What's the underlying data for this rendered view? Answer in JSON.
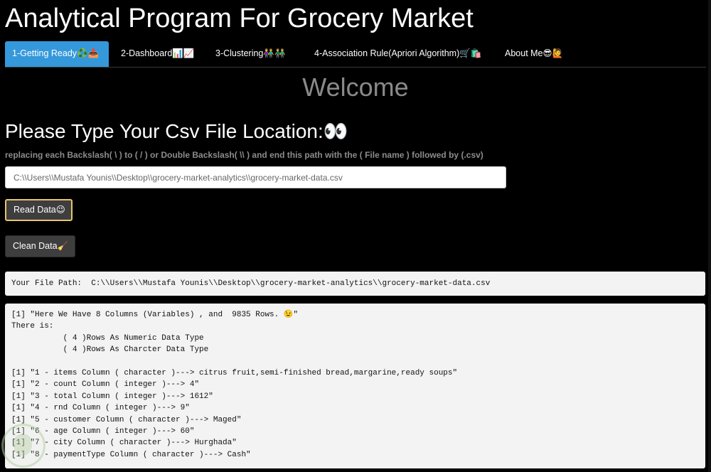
{
  "app": {
    "title": "Analytical Program For Grocery Market"
  },
  "tabs": [
    {
      "label": "1-Getting Ready♻️📥",
      "active": true
    },
    {
      "label": "2-Dashboard📊📈",
      "active": false
    },
    {
      "label": "3-Clustering👫👬",
      "active": false
    },
    {
      "label": "4-Association Rule(Apriori Algorithm)🛒🛍️",
      "active": false
    },
    {
      "label": "About Me😎🙋",
      "active": false
    }
  ],
  "main": {
    "welcome": "Welcome",
    "heading": "Please Type Your Csv File Location:👀",
    "hint": "replacing each Backslash( \\ ) to ( / ) or Double Backslash( \\\\ ) and end this path with the ( File name ) followed by (.csv)",
    "path_input": {
      "value": "C:\\\\Users\\\\Mustafa Younis\\\\Desktop\\\\grocery-market-analytics\\\\grocery-market-data.csv",
      "placeholder": ""
    },
    "read_button": "Read Data😉",
    "clean_button": "Clean Data🧹",
    "file_path_output": "Your File Path:  C:\\\\Users\\\\Mustafa Younis\\\\Desktop\\\\grocery-market-analytics\\\\grocery-market-data.csv",
    "console": [
      "[1] \"Here We Have 8 Columns (Variables) , and  9835 Rows. 😉\"",
      "There is:",
      "           ( 4 )Rows As Numeric Data Type",
      "           ( 4 )Rows As Charcter Data Type",
      "",
      "[1] \"1 - items Column ( character )---> citrus fruit,semi-finished bread,margarine,ready soups\"",
      "[1] \"2 - count Column ( integer )---> 4\"",
      "[1] \"3 - total Column ( integer )---> 1612\"",
      "[1] \"4 - rnd Column ( integer )---> 9\"",
      "[1] \"5 - customer Column ( character )---> Maged\"",
      "[1] \"6 - age Column ( integer )---> 60\"",
      "[1] \"7 - city Column ( character )---> Hurghada\"",
      "[1] \"8 - paymentType Column ( character )---> Cash\""
    ]
  },
  "colors": {
    "background": "#000000",
    "active_tab": "#3498db",
    "welcome_text": "#8a8a8a",
    "read_button_border": "#e8c46a",
    "button_bg": "#3e3e3e",
    "output_bg": "#f3f3f3"
  }
}
